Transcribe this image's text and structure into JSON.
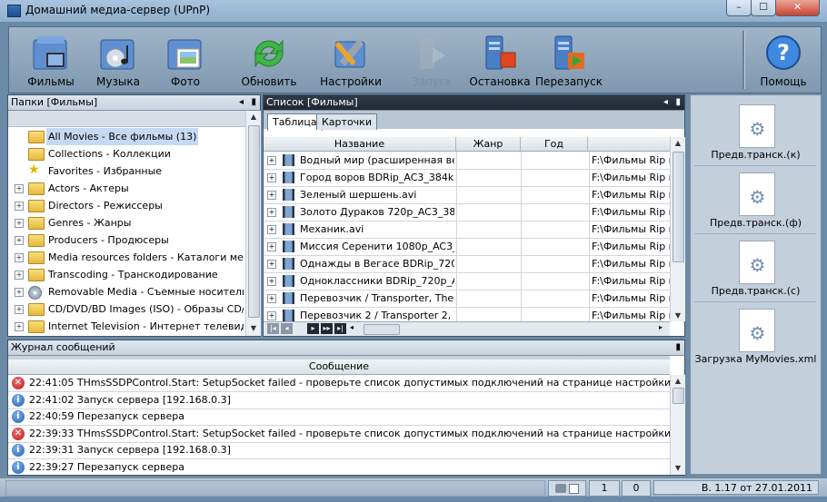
{
  "window": {
    "title": "Домашний медиа-сервер (UPnP)",
    "min": "–",
    "max": "☐",
    "close": "✕"
  },
  "toolbar": {
    "films": "Фильмы",
    "music": "Музыка",
    "photo": "Фото",
    "refresh": "Обновить",
    "settings": "Настройки",
    "start": "Запуск",
    "stop": "Остановка",
    "restart": "Перезапуск",
    "help": "Помощь"
  },
  "folders": {
    "header": "Папки [Фильмы]",
    "items": [
      {
        "label": "All Movies - Все фильмы (13)",
        "expandable": false,
        "icon": "folder-open-icon",
        "selected": true
      },
      {
        "label": "Collections - Коллекции",
        "expandable": false,
        "icon": "folder-icon"
      },
      {
        "label": "Favorites - Избранные",
        "expandable": false,
        "icon": "star-icon"
      },
      {
        "label": "Actors - Актеры",
        "expandable": true,
        "icon": "folder-icon"
      },
      {
        "label": "Directors - Режиссеры",
        "expandable": true,
        "icon": "folder-icon"
      },
      {
        "label": "Genres - Жанры",
        "expandable": true,
        "icon": "folder-icon"
      },
      {
        "label": "Producers - Продюсеры",
        "expandable": true,
        "icon": "folder-icon"
      },
      {
        "label": "Media resources folders - Каталоги мед",
        "expandable": true,
        "icon": "folder-icon"
      },
      {
        "label": "Transcoding - Транскодирование",
        "expandable": true,
        "icon": "folder-icon"
      },
      {
        "label": "Removable Media - Съемные носители",
        "expandable": true,
        "icon": "removable-disk-icon"
      },
      {
        "label": "CD/DVD/BD Images (ISO) - Образы CD/",
        "expandable": true,
        "icon": "folder-icon"
      },
      {
        "label": "Internet Television - Интернет телевид",
        "expandable": true,
        "icon": "folder-icon"
      }
    ]
  },
  "list": {
    "header": "Список [Фильмы]",
    "tabs": [
      "Таблица",
      "Карточки"
    ],
    "columns": [
      "Название",
      "Жанр",
      "Год"
    ],
    "rows": [
      {
        "name": "Водный мир (расширенная верси",
        "path": "F:\\Фильмы Rip и А"
      },
      {
        "name": "Город воров BDRip_AC3_384kb.m",
        "path": "F:\\Фильмы Rip и А"
      },
      {
        "name": "Зеленый шершень.avi",
        "path": "F:\\Фильмы Rip и А"
      },
      {
        "name": "Золото Дураков 720p_AC3_384kb",
        "path": "F:\\Фильмы Rip и А"
      },
      {
        "name": "Механик.avi",
        "path": "F:\\Фильмы Rip и А"
      },
      {
        "name": "Миссия Серенити 1080p_AC3_448",
        "path": "F:\\Фильмы Rip и А"
      },
      {
        "name": "Однажды в Вегасе BDRip_720p_D",
        "path": "F:\\Фильмы Rip и А"
      },
      {
        "name": "Одноклассники BDRip_720p_AC3_",
        "path": "F:\\Фильмы Rip и А"
      },
      {
        "name": "Перевозчик / Transporter, The (20",
        "path": "F:\\Фильмы Rip и А"
      },
      {
        "name": "Перевозчик 2 / Transporter 2, The",
        "path": "F:\\Фильмы Rip и А"
      }
    ]
  },
  "side_actions": [
    {
      "label": "Предв.транск.(к)"
    },
    {
      "label": "Предв.транск.(ф)"
    },
    {
      "label": "Предв.транск.(с)"
    },
    {
      "label": "Загрузка MyMovies.xml"
    }
  ],
  "log": {
    "header": "Журнал сообщений",
    "column": "Сообщение",
    "rows": [
      {
        "type": "error",
        "text": "22:41:05 THmsSSDPControl.Start: SetupSocket failed - проверьте список допустимых подключений на странице настройки Сервер."
      },
      {
        "type": "info",
        "text": "22:41:02 Запуск сервера [192.168.0.3]"
      },
      {
        "type": "info",
        "text": "22:40:59 Перезапуск сервера"
      },
      {
        "type": "error",
        "text": "22:39:33 THmsSSDPControl.Start: SetupSocket failed - проверьте список допустимых подключений на странице настройки Сервер."
      },
      {
        "type": "info",
        "text": "22:39:31 Запуск сервера [192.168.0.3]"
      },
      {
        "type": "info",
        "text": "22:39:27 Перезапуск сервера"
      }
    ]
  },
  "status": {
    "count1": "1",
    "count2": "0",
    "version": "В. 1.17 от 27.01.2011"
  }
}
